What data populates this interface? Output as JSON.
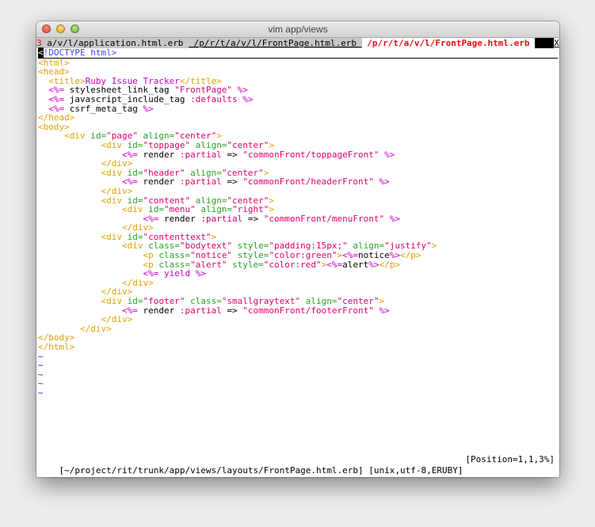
{
  "window": {
    "title": "vim app/views"
  },
  "tabline": {
    "tab1_num": "3",
    "tab1_label": " a/v/l/application.html.erb ",
    "tab2_label": " /p/r/t/a/v/l/FrontPage.html.erb ",
    "active_label": " /p/r/t/a/v/l/FrontPage.html.erb ",
    "close_label": "X"
  },
  "lines": [
    [
      [
        "cursor",
        "<"
      ],
      [
        "doctype",
        "!DOCTYPE html>"
      ]
    ],
    [
      [
        "tag",
        "<html>"
      ]
    ],
    [
      [
        "tag",
        "<head>"
      ]
    ],
    [
      [
        "tag",
        "  <title>"
      ],
      [
        "ttl",
        "Ruby Issue Tracker"
      ],
      [
        "tag",
        "</title>"
      ]
    ],
    [
      [
        "erb",
        "  <%="
      ],
      [
        "plain",
        " stylesheet_link_tag "
      ],
      [
        "str",
        "\"FrontPage\""
      ],
      [
        "erb",
        " %>"
      ]
    ],
    [
      [
        "erb",
        "  <%="
      ],
      [
        "plain",
        " javascript_include_tag "
      ],
      [
        "sym",
        ":defaults"
      ],
      [
        "erb",
        " %>"
      ]
    ],
    [
      [
        "erb",
        "  <%="
      ],
      [
        "plain",
        " csrf_meta_tag "
      ],
      [
        "erb",
        "%>"
      ]
    ],
    [
      [
        "tag",
        "</head>"
      ]
    ],
    [
      [
        "tag",
        "<body>"
      ]
    ],
    [
      [
        "tag",
        "     <div "
      ],
      [
        "attr",
        "id="
      ],
      [
        "str",
        "\"page\""
      ],
      [
        "attr",
        " align="
      ],
      [
        "str",
        "\"center\""
      ],
      [
        "tag",
        ">"
      ]
    ],
    [
      [
        "tag",
        "            <div "
      ],
      [
        "attr",
        "id="
      ],
      [
        "str",
        "\"toppage\""
      ],
      [
        "attr",
        " align="
      ],
      [
        "str",
        "\"center\""
      ],
      [
        "tag",
        ">"
      ]
    ],
    [
      [
        "erb",
        "                <%="
      ],
      [
        "plain",
        " render "
      ],
      [
        "sym",
        ":partial"
      ],
      [
        "plain",
        " => "
      ],
      [
        "str",
        "\"commonFront/toppageFront\""
      ],
      [
        "erb",
        " %>"
      ]
    ],
    [
      [
        "tag",
        "            </div>"
      ]
    ],
    [
      [
        "tag",
        "            <div "
      ],
      [
        "attr",
        "id="
      ],
      [
        "str",
        "\"header\""
      ],
      [
        "attr",
        " align="
      ],
      [
        "str",
        "\"center\""
      ],
      [
        "tag",
        ">"
      ]
    ],
    [
      [
        "erb",
        "                <%="
      ],
      [
        "plain",
        " render "
      ],
      [
        "sym",
        ":partial"
      ],
      [
        "plain",
        " => "
      ],
      [
        "str",
        "\"commonFront/headerFront\""
      ],
      [
        "erb",
        " %>"
      ]
    ],
    [
      [
        "tag",
        "            </div>"
      ]
    ],
    [
      [
        "tag",
        "            <div "
      ],
      [
        "attr",
        "id="
      ],
      [
        "str",
        "\"content\""
      ],
      [
        "attr",
        " align="
      ],
      [
        "str",
        "\"center\""
      ],
      [
        "tag",
        ">"
      ]
    ],
    [
      [
        "tag",
        "                <div "
      ],
      [
        "attr",
        "id="
      ],
      [
        "str",
        "\"menu\""
      ],
      [
        "attr",
        " align="
      ],
      [
        "str",
        "\"right\""
      ],
      [
        "tag",
        ">"
      ]
    ],
    [
      [
        "erb",
        "                    <%="
      ],
      [
        "plain",
        " render "
      ],
      [
        "sym",
        ":partial"
      ],
      [
        "plain",
        " => "
      ],
      [
        "str",
        "\"commonFront/menuFront\""
      ],
      [
        "erb",
        " %>"
      ]
    ],
    [
      [
        "tag",
        "                </div>"
      ]
    ],
    [
      [
        "tag",
        "            <div "
      ],
      [
        "attr",
        "id="
      ],
      [
        "str",
        "\"contenttext\""
      ],
      [
        "tag",
        ">"
      ]
    ],
    [
      [
        "tag",
        "                <div "
      ],
      [
        "attr",
        "class="
      ],
      [
        "str",
        "\"bodytext\""
      ],
      [
        "attr",
        " style="
      ],
      [
        "str",
        "\"padding:15px;\""
      ],
      [
        "attr",
        " align="
      ],
      [
        "str",
        "\"justify\""
      ],
      [
        "tag",
        ">"
      ]
    ],
    [
      [
        "tag",
        "                    <p "
      ],
      [
        "attr",
        "class="
      ],
      [
        "str",
        "\"notice\""
      ],
      [
        "attr",
        " style="
      ],
      [
        "str",
        "\"color:green\""
      ],
      [
        "tag",
        ">"
      ],
      [
        "erb",
        "<%="
      ],
      [
        "plain",
        "notice"
      ],
      [
        "erb",
        "%>"
      ],
      [
        "tag",
        "</p>"
      ]
    ],
    [
      [
        "tag",
        "                    <p "
      ],
      [
        "attr",
        "class="
      ],
      [
        "str",
        "\"alert\""
      ],
      [
        "attr",
        " style="
      ],
      [
        "str",
        "\"color:red\""
      ],
      [
        "tag",
        ">"
      ],
      [
        "erb",
        "<%="
      ],
      [
        "plain",
        "alert"
      ],
      [
        "erb",
        "%>"
      ],
      [
        "tag",
        "</p>"
      ]
    ],
    [
      [
        "erb",
        "                    <%="
      ],
      [
        "ttl",
        " yield "
      ],
      [
        "erb",
        "%>"
      ]
    ],
    [
      [
        "tag",
        "                </div>"
      ]
    ],
    [
      [
        "tag",
        "            </div>"
      ]
    ],
    [
      [
        "tag",
        "            <div "
      ],
      [
        "attr",
        "id="
      ],
      [
        "str",
        "\"footer\""
      ],
      [
        "attr",
        " class="
      ],
      [
        "str",
        "\"smallgraytext\""
      ],
      [
        "attr",
        " align="
      ],
      [
        "str",
        "\"center\""
      ],
      [
        "tag",
        ">"
      ]
    ],
    [
      [
        "erb",
        "                <%="
      ],
      [
        "plain",
        " render "
      ],
      [
        "sym",
        ":partial"
      ],
      [
        "plain",
        " => "
      ],
      [
        "str",
        "\"commonFront/footerFront\""
      ],
      [
        "erb",
        " %>"
      ]
    ],
    [
      [
        "tag",
        "            </div>"
      ]
    ],
    [
      [
        "tag",
        "        </div>"
      ]
    ],
    [
      [
        "tag",
        "</body>"
      ]
    ],
    [
      [
        "tag",
        "</html>"
      ]
    ],
    [
      [
        "tilde",
        "~"
      ]
    ],
    [
      [
        "tilde",
        "~"
      ]
    ],
    [
      [
        "tilde",
        "~"
      ]
    ],
    [
      [
        "tilde",
        "~"
      ]
    ],
    [
      [
        "tilde",
        "~"
      ]
    ]
  ],
  "status": {
    "file": "[~/project/rit/trunk/app/views/layouts/FrontPage.html.erb] [unix,utf-8,ERUBY]",
    "position": "[Position=1,1,3%]"
  }
}
